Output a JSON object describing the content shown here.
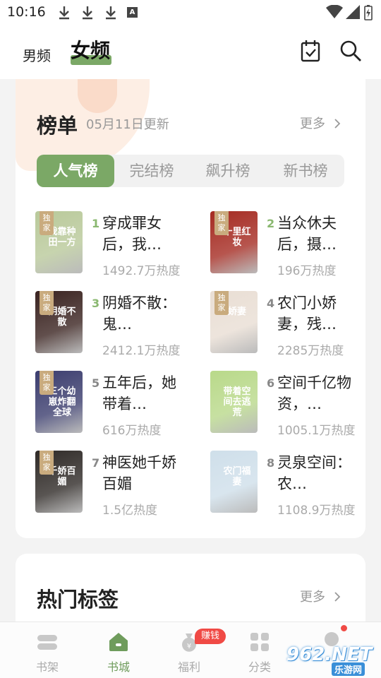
{
  "status_bar": {
    "time": "10:16",
    "a_label": "A"
  },
  "header": {
    "tab_male": "男频",
    "tab_female": "女频"
  },
  "ranking": {
    "title": "榜单",
    "update_date": "05月11日更新",
    "more": "更多",
    "tabs": [
      "人气榜",
      "完结榜",
      "飙升榜",
      "新书榜"
    ],
    "active_tab": 0,
    "badge_text": "独家",
    "books": [
      {
        "rank": "1",
        "title": "穿成罪女后，我…",
        "heat": "1492.7万热度",
        "cover_text": "我靠种田一方",
        "cover_color": "#b9c99a",
        "exclusive": true
      },
      {
        "rank": "2",
        "title": "当众休夫后，摄…",
        "heat": "196万热度",
        "cover_text": "十里红妆",
        "cover_color": "#a52b22",
        "exclusive": true
      },
      {
        "rank": "3",
        "title": "阴婚不散：鬼…",
        "heat": "2412.1万热度",
        "cover_text": "阴婚不散",
        "cover_color": "#3a2320",
        "exclusive": true
      },
      {
        "rank": "4",
        "title": "农门小娇妻，残…",
        "heat": "2285万热度",
        "cover_text": "娇妻",
        "cover_color": "#e9ded4",
        "exclusive": true
      },
      {
        "rank": "5",
        "title": "五年后，她带着…",
        "heat": "616万热度",
        "cover_text": "三个幼崽炸翻全球",
        "cover_color": "#3b3d6e",
        "exclusive": true
      },
      {
        "rank": "6",
        "title": "空间千亿物资，…",
        "heat": "1005.1万热度",
        "cover_text": "带着空间去逃荒",
        "cover_color": "#b9d98a",
        "exclusive": false
      },
      {
        "rank": "7",
        "title": "神医她千娇百媚",
        "heat": "1.5亿热度",
        "cover_text": "千娇百媚",
        "cover_color": "#2f2a27",
        "exclusive": true
      },
      {
        "rank": "8",
        "title": "灵泉空间：农…",
        "heat": "1108.9万热度",
        "cover_text": "农门福妻",
        "cover_color": "#cfdfea",
        "exclusive": false
      }
    ]
  },
  "tags": {
    "title": "热门标签",
    "more": "更多"
  },
  "bottom_nav": {
    "items": [
      "书架",
      "书城",
      "福利",
      "分类",
      ""
    ],
    "active": 1,
    "earn_badge": "赚钱"
  },
  "watermark": {
    "main": "962.NET",
    "sub": "乐游网"
  },
  "colors": {
    "accent": "#7ba866",
    "badge": "#c9ab7e",
    "alert": "#f04a45"
  }
}
